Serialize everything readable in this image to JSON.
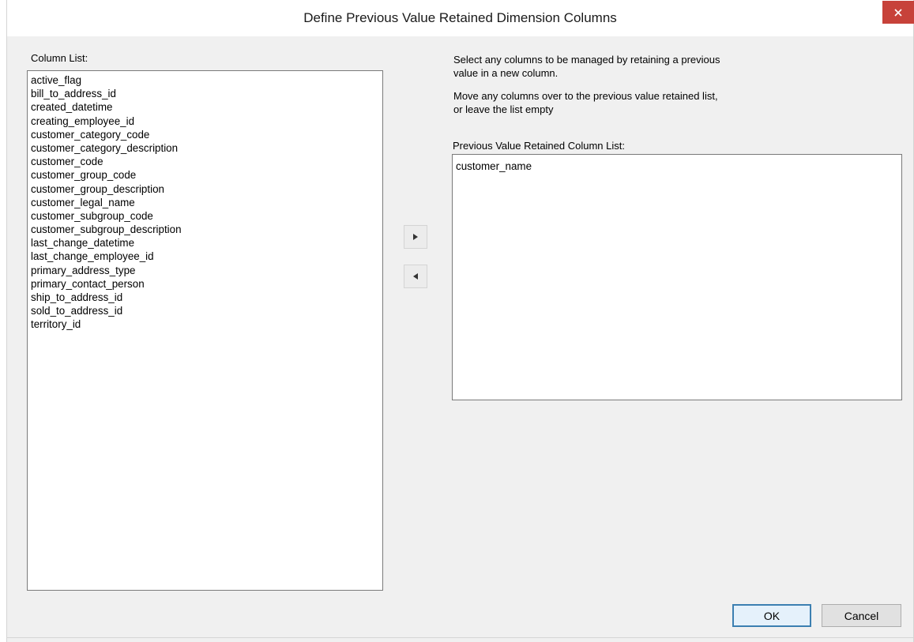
{
  "window": {
    "title": "Define Previous Value Retained Dimension Columns",
    "close_icon": "close-icon"
  },
  "column_list": {
    "label": "Column List:",
    "items": [
      "active_flag",
      "bill_to_address_id",
      "created_datetime",
      "creating_employee_id",
      "customer_category_code",
      "customer_category_description",
      "customer_code",
      "customer_group_code",
      "customer_group_description",
      "customer_legal_name",
      "customer_subgroup_code",
      "customer_subgroup_description",
      "last_change_datetime",
      "last_change_employee_id",
      "primary_address_type",
      "primary_contact_person",
      "ship_to_address_id",
      "sold_to_address_id",
      "territory_id"
    ]
  },
  "instructions": {
    "line1": "Select any columns to be managed by retaining a previous",
    "line2": "value in a new column.",
    "line3": "Move any columns over to the previous value retained list,",
    "line4": "or leave the list empty"
  },
  "retained_list": {
    "label": "Previous Value Retained Column List:",
    "items": [
      "customer_name"
    ]
  },
  "move_buttons": {
    "right_icon": "triangle-right-icon",
    "left_icon": "triangle-left-icon"
  },
  "buttons": {
    "ok": "OK",
    "cancel": "Cancel"
  },
  "colors": {
    "close_button": "#c7423a",
    "dialog_background": "#f0f0f0",
    "default_button_border": "#3c7fb1"
  }
}
